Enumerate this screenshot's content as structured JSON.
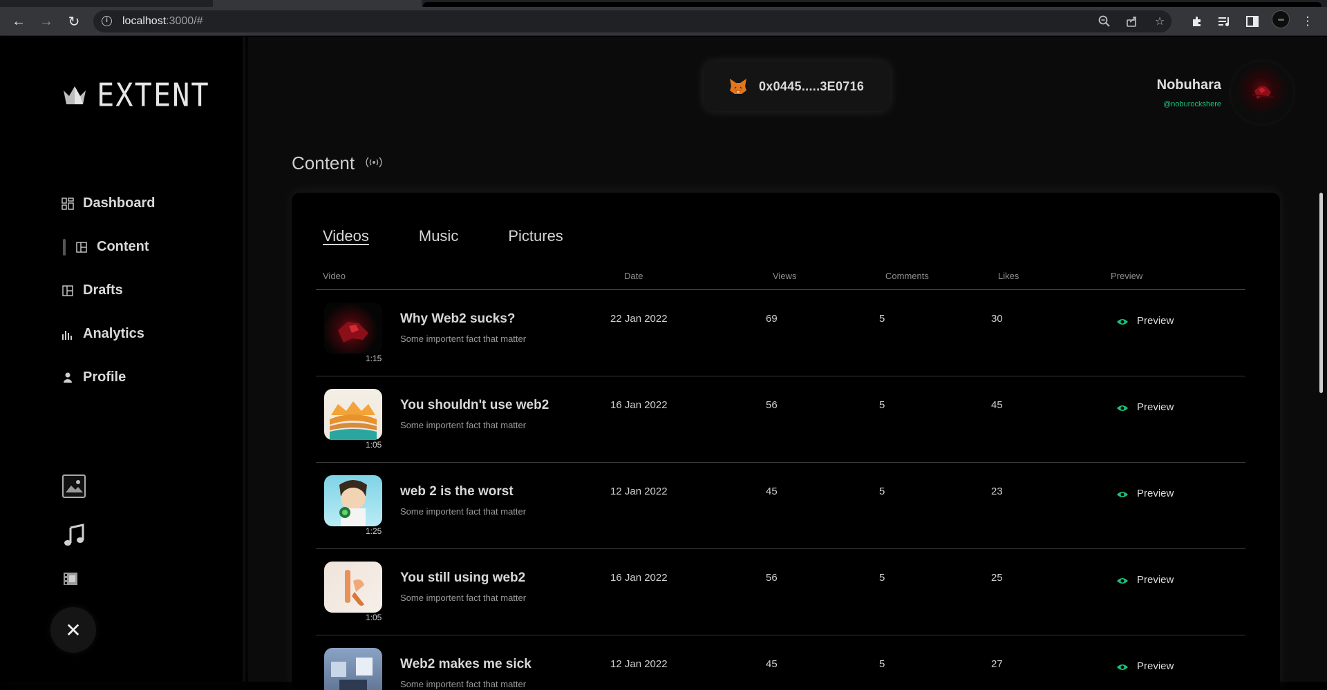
{
  "browser": {
    "url_host": "localhost",
    "url_path": ":3000/#"
  },
  "app": {
    "logo_text": "EXTENT"
  },
  "sidebar": {
    "items": [
      {
        "label": "Dashboard",
        "icon": "grid-icon"
      },
      {
        "label": "Content",
        "icon": "layout-icon",
        "active": true
      },
      {
        "label": "Drafts",
        "icon": "drafts-icon"
      },
      {
        "label": "Analytics",
        "icon": "bar-chart-icon"
      },
      {
        "label": "Profile",
        "icon": "user-icon"
      }
    ],
    "close_glyph": "✕"
  },
  "header": {
    "wallet_address": "0x0445.....3E0716",
    "user_name": "Nobuhara",
    "user_handle": "@noburockshere"
  },
  "main": {
    "page_title": "Content",
    "tabs": [
      {
        "label": "Videos",
        "active": true
      },
      {
        "label": "Music",
        "active": false
      },
      {
        "label": "Pictures",
        "active": false
      }
    ],
    "columns": [
      "Video",
      "Date",
      "Views",
      "Comments",
      "Likes",
      "Preview"
    ],
    "preview_label": "Preview",
    "accent_color": "#19c37d",
    "rows": [
      {
        "title": "Why Web2 sucks?",
        "subtitle": "Some importent fact that matter",
        "duration": "1:15",
        "date": "22 Jan 2022",
        "views": "69",
        "comments": "5",
        "likes": "30"
      },
      {
        "title": "You shouldn't use web2",
        "subtitle": "Some importent fact that matter",
        "duration": "1:05",
        "date": "16 Jan 2022",
        "views": "56",
        "comments": "5",
        "likes": "45"
      },
      {
        "title": "web 2 is the worst",
        "subtitle": "Some importent fact that matter",
        "duration": "1:25",
        "date": "12 Jan 2022",
        "views": "45",
        "comments": "5",
        "likes": "23"
      },
      {
        "title": "You still using web2",
        "subtitle": "Some importent fact that matter",
        "duration": "1:05",
        "date": "16 Jan 2022",
        "views": "56",
        "comments": "5",
        "likes": "25"
      },
      {
        "title": "Web2 makes me sick",
        "subtitle": "Some importent fact that matter",
        "duration": "",
        "date": "12 Jan 2022",
        "views": "45",
        "comments": "5",
        "likes": "27"
      }
    ]
  }
}
